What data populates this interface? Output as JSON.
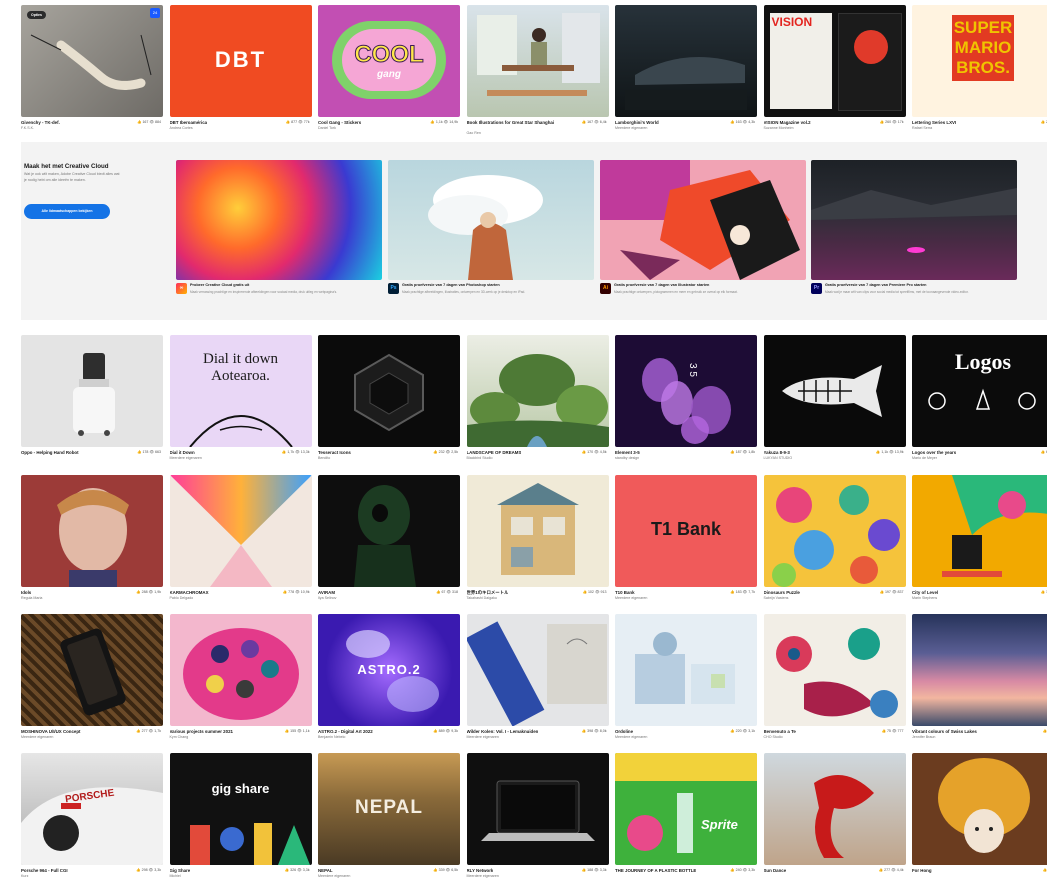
{
  "promo": {
    "title": "Maak het met Creative Cloud",
    "description": "Wat je ook wilt maken, Adobe Creative Cloud biedt alles wat je nodig hebt om ​alle ideeën te maken.",
    "cta_label": "Alle lidmaatschappen bekijken",
    "cards": [
      {
        "app_icon": "creative-cloud-icon",
        "app_label": "",
        "title": "Probeer Creative Cloud gratis uit",
        "desc": "Maak verrassing prachtige en inspirerende afbeeldingen voor sociaal media, druk uitleg en webpagina's."
      },
      {
        "app_icon": "photoshop-icon",
        "app_label": "Ps",
        "title": "Gratis proefversie van 7 dagen van Photoshop starten",
        "desc": "Maak prachtige afbeeldingen, illustraties, ontwerpen en 3D-werk op je desktop en iPad."
      },
      {
        "app_icon": "illustrator-icon",
        "app_label": "Ai",
        "title": "Gratis proefversie van 7 dagen van Illustrator starten",
        "desc": "Maak prachtige ontwerpen, pictogrammen en meer en gebruik ze overal op elk formaat."
      },
      {
        "app_icon": "premiere-pro-icon",
        "app_label": "Pr",
        "title": "Gratis proefversie van 7 dagen van Premiere Pro starten",
        "desc": "Maak wat je maar wilt van clips voor social media tot speelfilms, met de toonaangevende video-editor."
      }
    ]
  },
  "rows": [
    [
      {
        "title": "Givenchy - TK-def.",
        "owner": "F.K.S.K.",
        "likes": "167",
        "views": "884",
        "badge": "Opties",
        "badge2": "24",
        "bg": "#8d8b86"
      },
      {
        "title": "DBT Iberoamérica",
        "owner": "Andrea Cortes",
        "likes": "877",
        "views": "77k",
        "art": "DBT",
        "bg": "#f04b22"
      },
      {
        "title": "Cool Gang - Stickers",
        "owner": "Daniel Tork",
        "likes": "1,1k",
        "views": "14,9k",
        "art": "COOL",
        "art2": "gang",
        "bg": "#ef4fa0"
      },
      {
        "title": "Book Illustrations for Great Star Shanghai",
        "owner": "Gao Ren",
        "likes": "167",
        "views": "6,4k",
        "bg": "#c9d7df"
      },
      {
        "title": "Lamborghini's World",
        "owner": "Meerdere eigenaren",
        "likes": "163",
        "views": "4,3k",
        "bg": "#1a2024"
      },
      {
        "title": "VISION Magazine vol.2",
        "owner": "Suzanne Monheim",
        "likes": "260",
        "views": "17k",
        "art": "VISION",
        "bg": "#111"
      },
      {
        "title": "Lettering Series LXVI",
        "owner": "Rafael Serra",
        "likes": "208",
        "views": "",
        "art": "SUPER MARIO BROS.",
        "bg": "#fff3e0"
      }
    ],
    [
      {
        "title": "Oppo - Helping Hand Robot",
        "owner": "",
        "likes": "178",
        "views": "663",
        "bg": "#e4e4e4"
      },
      {
        "title": "Dial it Down",
        "owner": "Meerdere eigenaren",
        "likes": "1,7k",
        "views": "13,3k",
        "art": "Dial it down Aotearoa.",
        "bg": "#e9d7f6"
      },
      {
        "title": "Tesseract Icons",
        "owner": "Bendito",
        "likes": "232",
        "views": "2,5k",
        "bg": "#0b0b0b"
      },
      {
        "title": "LANDSCAPE OF DREAMS",
        "owner": "Blackbird Studio",
        "likes": "170",
        "views": "4,5k",
        "bg": "#6f9461"
      },
      {
        "title": "Element 3-5",
        "owner": "standby design",
        "likes": "187",
        "views": "1,8k",
        "art": "3 5",
        "bg": "#1d0c35"
      },
      {
        "title": "Yakuza 8-9-3",
        "owner": "LUKYAN STUDIO",
        "likes": "1,1k",
        "views": "13,9k",
        "bg": "#0a0a0a"
      },
      {
        "title": "Logos over the years",
        "owner": "Mario de Meyer",
        "likes": "660",
        "views": "",
        "art": "Logos",
        "bg": "#0b0b0b"
      }
    ],
    [
      {
        "title": "Idols",
        "owner": "Regula Maria",
        "likes": "288",
        "views": "1,9k",
        "bg": "#9c3b38"
      },
      {
        "title": "KARMACHROMAX",
        "owner": "Pablo Delgado",
        "likes": "778",
        "views": "10,9k",
        "bg": "#f2e7df"
      },
      {
        "title": "AVIRAM",
        "owner": "Ilya Selinov",
        "likes": "67",
        "views": "318",
        "bg": "#0e0e0e"
      },
      {
        "title": "世界1のキロメートル",
        "owner": "Takahashi Daigaku",
        "likes": "102",
        "views": "913",
        "bg": "#f0ead7"
      },
      {
        "title": "T10 Bank",
        "owner": "Meerdere eigenaren",
        "likes": "183",
        "views": "7,7k",
        "art": "T1 Bank",
        "bg": "#f05a5a"
      },
      {
        "title": "Dinosaurs Puzzle",
        "owner": "Sabrijn Vastens",
        "likes": "197",
        "views": "837",
        "bg": "#f5c33b"
      },
      {
        "title": "City of Level",
        "owner": "Marin Stephens",
        "likes": "160",
        "views": "",
        "bg": "#f2a900"
      }
    ],
    [
      {
        "title": "MOSHINOVA U/I/UX Concept",
        "owner": "Meerdere eigenaren",
        "likes": "277",
        "views": "1,7k",
        "bg": "#3b2a18"
      },
      {
        "title": "Various projects summer 2021",
        "owner": "Kym Chang",
        "likes": "155",
        "views": "1,1k",
        "bg": "#f3b7cd"
      },
      {
        "title": "ASTRO.2 - Digital Art 2022",
        "owner": "Benjamin Nebelo",
        "likes": "889",
        "views": "9,3k",
        "art": "ASTRO.2",
        "bg": "#4a2bd1"
      },
      {
        "title": "Wilder Kolen: Vol. I - Lemaknuiden",
        "owner": "Meerdere eigenaren",
        "likes": "398",
        "views": "8,0k",
        "bg": "#e4e5e7"
      },
      {
        "title": "Ordoline",
        "owner": "Meerdere eigenaren",
        "likes": "220",
        "views": "3,1k",
        "bg": "#e6eef4"
      },
      {
        "title": "Benvenuto a Te",
        "owner": "CHO Studio",
        "likes": "75",
        "views": "777",
        "bg": "#f2eee6"
      },
      {
        "title": "Vibrant colours of Swiss Lakes",
        "owner": "Jennifer Braun",
        "likes": "84",
        "views": "",
        "bg": "#3f5c8f"
      }
    ],
    [
      {
        "title": "Porsche 964 - Full CGI",
        "owner": "Kurz",
        "likes": "298",
        "views": "3,3k",
        "art": "PORSCHE",
        "bg": "#dcdcdc"
      },
      {
        "title": "Gig Share",
        "owner": "Michiel",
        "likes": "326",
        "views": "3,3k",
        "art": "gig share",
        "bg": "#111"
      },
      {
        "title": "NEPAL",
        "owner": "Meerdere eigenaren",
        "likes": "339",
        "views": "6,5k",
        "art": "NEPAL",
        "bg": "#6a5130"
      },
      {
        "title": "RLY Network",
        "owner": "Meerdere eigenaren",
        "likes": "188",
        "views": "3,3k",
        "bg": "#0f0f0f"
      },
      {
        "title": "THE JOURNEY OF A PLASTIC BOTTLE",
        "owner": "",
        "likes": "240",
        "views": "3,3k",
        "art": "Sprite",
        "bg": "#3eb13c"
      },
      {
        "title": "Sun Dance",
        "owner": "",
        "likes": "277",
        "views": "4,4k",
        "bg": "#cfd8de"
      },
      {
        "title": "For Hong",
        "owner": "",
        "likes": "40",
        "views": "",
        "bg": "#6b3c1f"
      }
    ]
  ],
  "icons": {
    "like": "thumbs-up-icon",
    "view": "eye-icon"
  },
  "colors": {
    "accent": "#1473e6",
    "ps": "#001e36",
    "ai": "#330000",
    "pr": "#00005b"
  }
}
